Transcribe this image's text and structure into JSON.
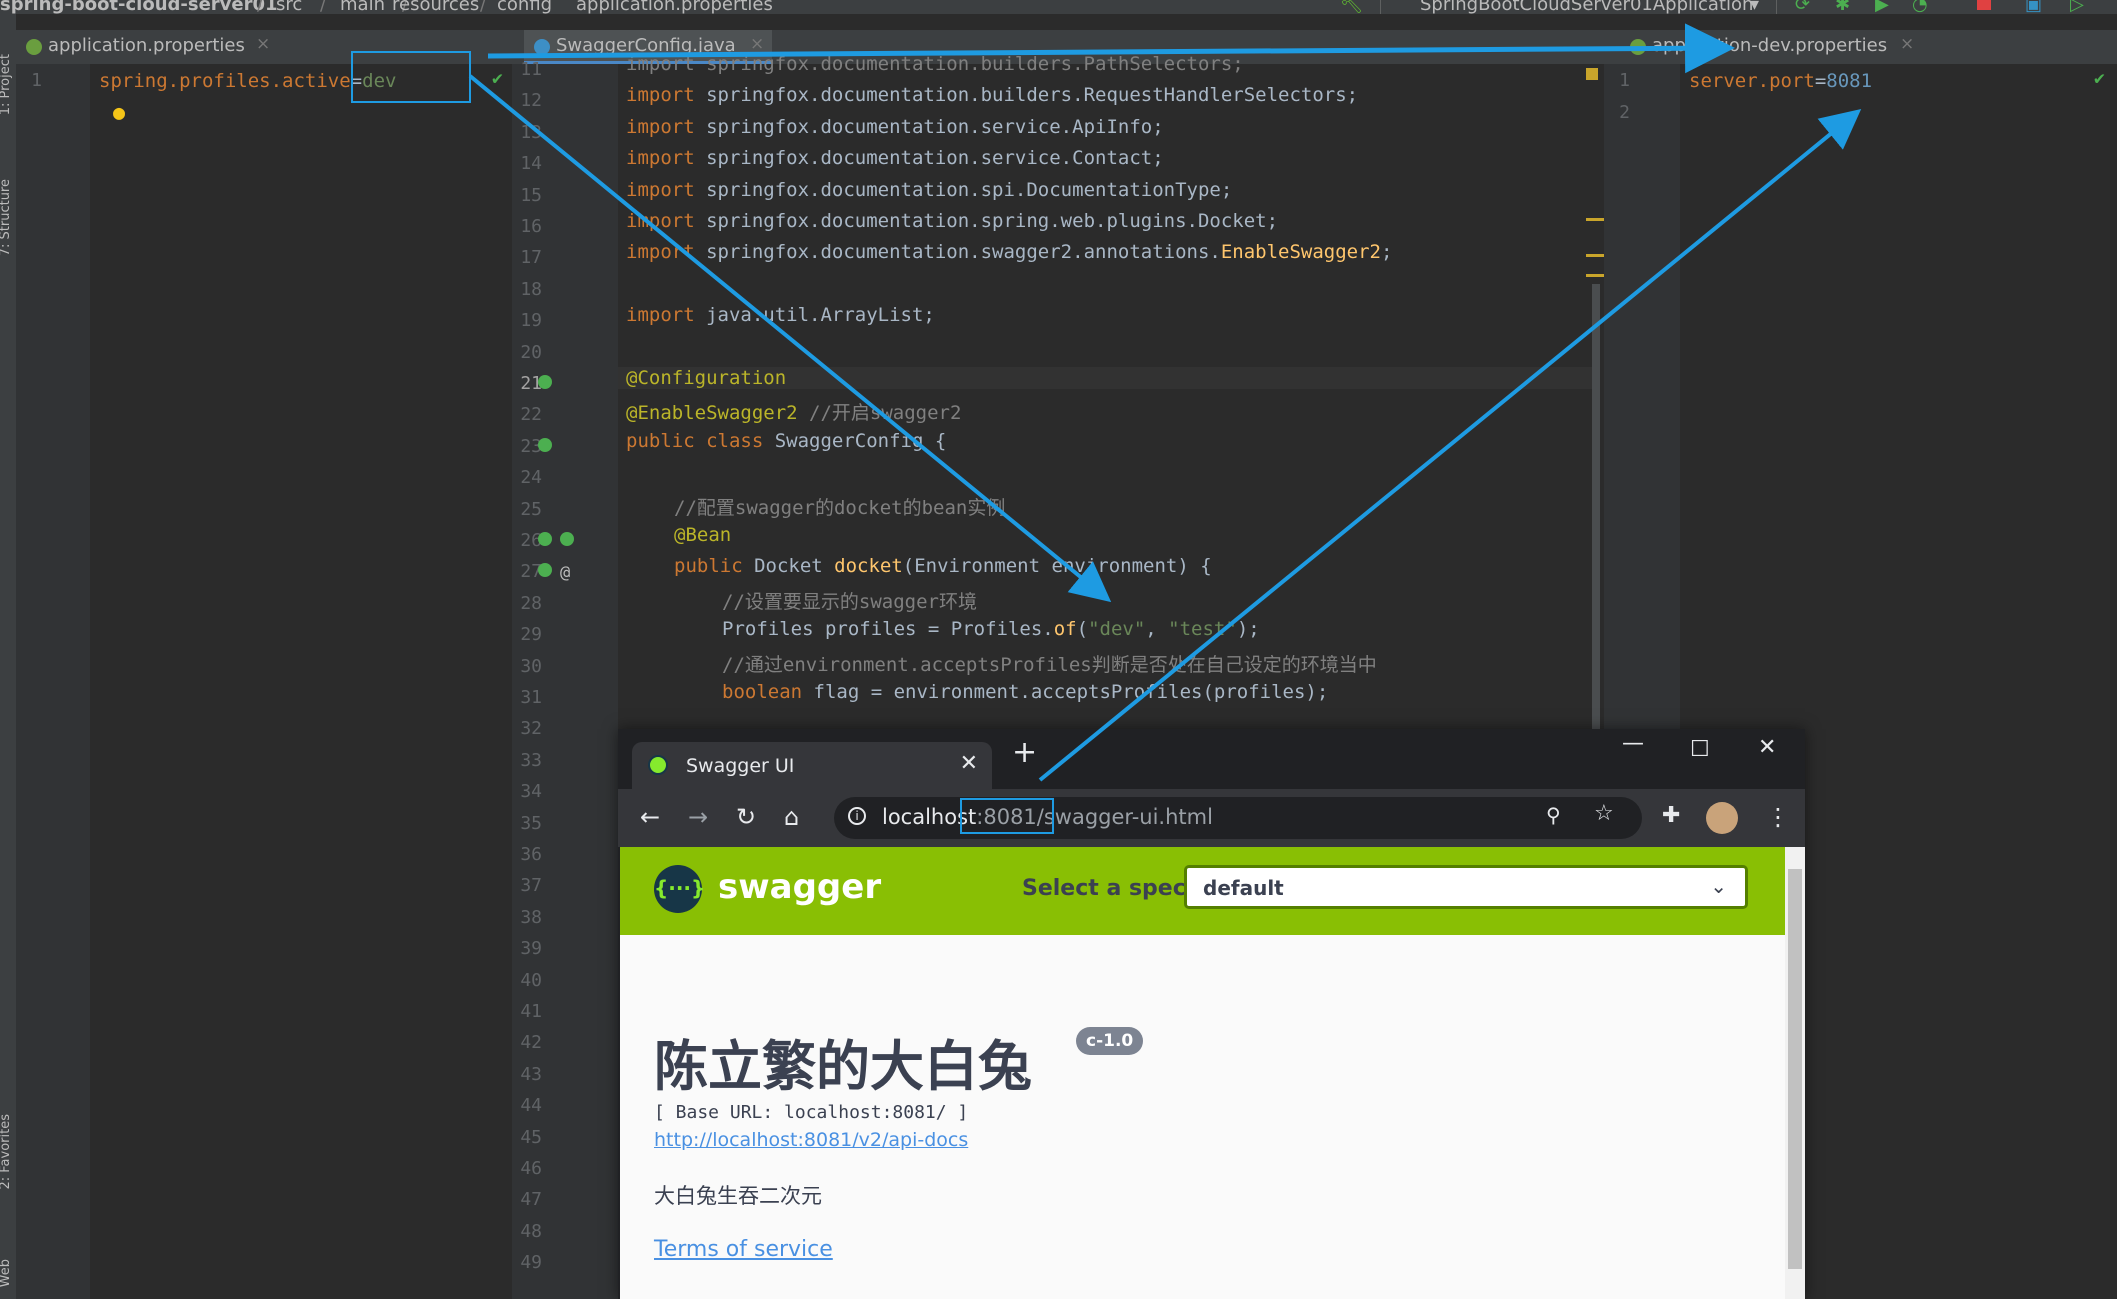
{
  "breadcrumb": [
    "spring-boot-cloud-server01",
    "src",
    "main",
    "resources",
    "config",
    "application.properties"
  ],
  "run_config": "SpringBootCloudServer01Application",
  "tool_windows": [
    "1: Project",
    "7: Structure",
    "2: Favorites",
    "Web"
  ],
  "tabs": [
    {
      "label": "application.properties",
      "close": "×"
    },
    {
      "label": "SwaggerConfig.java",
      "close": "×"
    },
    {
      "label": "application-dev.properties",
      "close": "×"
    }
  ],
  "left_editor": {
    "line_number": "1",
    "key": "spring.profiles.active",
    "eq": "=",
    "value": "dev"
  },
  "middle_editor": {
    "line_numbers": [
      "11",
      "12",
      "13",
      "14",
      "15",
      "16",
      "17",
      "18",
      "19",
      "20",
      "21",
      "22",
      "23",
      "24",
      "25",
      "26",
      "27",
      "28",
      "29",
      "30",
      "31",
      "32",
      "33",
      "34",
      "35",
      "36",
      "37",
      "38",
      "39",
      "40",
      "41",
      "42",
      "43",
      "44",
      "45",
      "46",
      "47",
      "48",
      "49"
    ],
    "lines": {
      "l11": "import springfox.documentation.builders.PathSelectors;",
      "l12_pkg": "springfox.documentation.builders.RequestHandlerSelectors;",
      "l13_pkg": "springfox.documentation.service.ApiInfo;",
      "l14_pkg": "springfox.documentation.service.Contact;",
      "l15_pkg": "springfox.documentation.spi.DocumentationType;",
      "l16_pkg": "springfox.documentation.spring.web.plugins.Docket;",
      "l17_pkg": "springfox.documentation.swagger2.annotations.",
      "l17_cls": "EnableSwagger2",
      "l19_pkg": "java.util.ArrayList;",
      "import_kw": "import",
      "l21": "@Configuration",
      "l22_ann": "@EnableSwagger2",
      "l22_cmt": " //开启swagger2",
      "l23_kw": "public class",
      "l23_rest": " SwaggerConfig {",
      "l25": "//配置swagger的docket的bean实例",
      "l26": "@Bean",
      "l27_kw": "public",
      "l27_type": " Docket ",
      "l27_fn": "docket",
      "l27_rest": "(Environment environment) {",
      "l28": "//设置要显示的swagger环境",
      "l29_a": "Profiles profiles = Profiles.",
      "l29_of": "of",
      "l29_b": "(",
      "l29_s1": "\"dev\"",
      "l29_c": ", ",
      "l29_s2": "\"test\"",
      "l29_d": ");",
      "l30": "//通过environment.acceptsProfiles判断是否处在自己设定的环境当中",
      "l31_kw": "boolean",
      "l31_rest": " flag = environment.acceptsProfiles(profiles);"
    }
  },
  "right_editor": {
    "line_numbers": [
      "1",
      "2"
    ],
    "key": "server.port",
    "eq": "=",
    "value": "8081"
  },
  "browser": {
    "tab_title": "Swagger UI",
    "tab_close": "✕",
    "new_tab": "+",
    "win_min": "—",
    "win_max": "☐",
    "win_close": "✕",
    "url_host": "localhost",
    "url_rest": ":8081/swagger-ui.html",
    "info_icon": "i"
  },
  "swagger": {
    "brand": "swagger",
    "logo_glyph": "{···}",
    "select_spec_label": "Select a spec",
    "spec_value": "default",
    "title": "陈立繁的大白兔",
    "version": "c-1.0",
    "base_url": "[ Base URL: localhost:8081/ ]",
    "api_docs_link": "http://localhost:8081/v2/api-docs",
    "description": "大白兔生吞二次元",
    "terms_link": "Terms of service"
  },
  "colors": {
    "annotation_blue": "#1e9be2",
    "swagger_green": "#89bf04",
    "ide_bg": "#2b2b2b"
  }
}
